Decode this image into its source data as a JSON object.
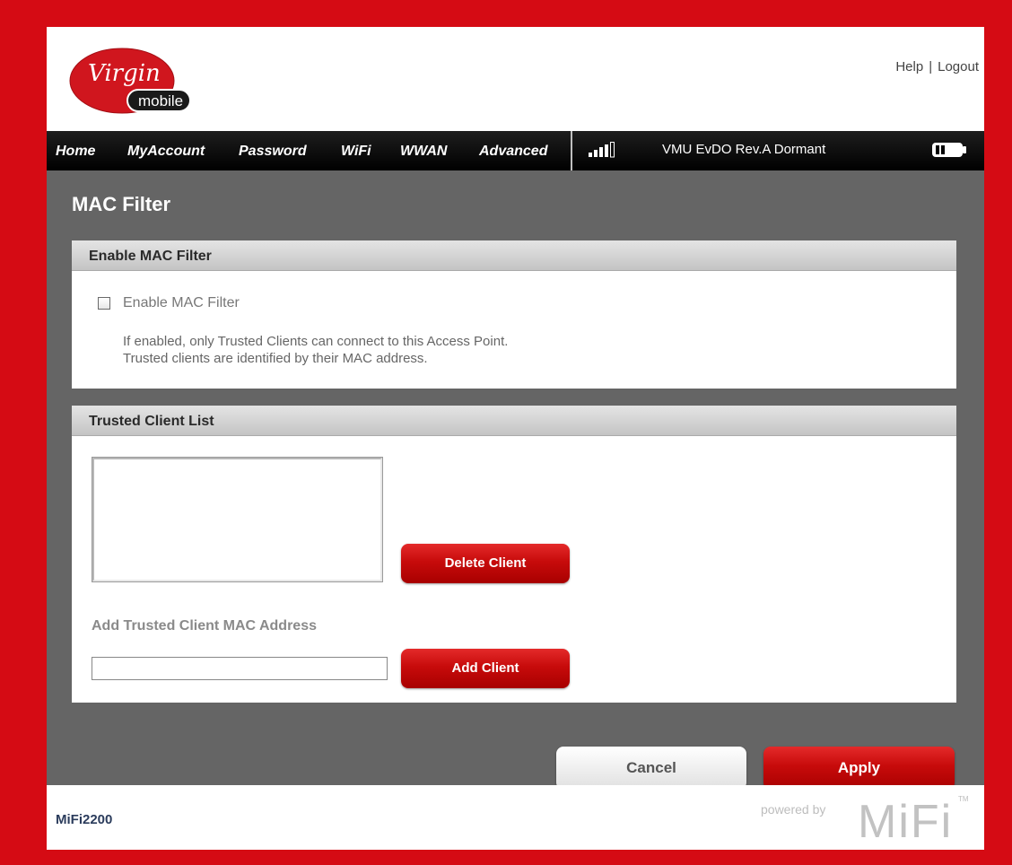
{
  "header": {
    "logo": {
      "brand_top": "Virgin",
      "brand_bottom": "mobile",
      "icon": "virgin-mobile-logo"
    },
    "links": {
      "help": "Help",
      "separator": "|",
      "logout": "Logout"
    }
  },
  "nav": {
    "items": [
      "Home",
      "MyAccount",
      "Password",
      "WiFi",
      "WWAN",
      "Advanced"
    ],
    "status": "VMU  EvDO Rev.A  Dormant",
    "signal_icon": "signal-strength-icon",
    "battery_icon": "battery-icon"
  },
  "page": {
    "title": "MAC Filter"
  },
  "enable_panel": {
    "header": "Enable MAC Filter",
    "checkbox_label": "Enable MAC Filter",
    "checked": false,
    "description_line1": "If enabled, only Trusted Clients can connect to this Access Point.",
    "description_line2": "Trusted clients are identified by their MAC address."
  },
  "trusted_panel": {
    "header": "Trusted Client List",
    "clients": [],
    "delete_label": "Delete Client",
    "add_title": "Add Trusted Client MAC Address",
    "mac_value": "",
    "add_label": "Add Client"
  },
  "actions": {
    "cancel_label": "Cancel",
    "apply_label": "Apply"
  },
  "footer": {
    "model": "MiFi2200",
    "powered_by": "powered by",
    "brand": "MiFi",
    "trademark": "TM"
  },
  "colors": {
    "frame_red": "#d50b14",
    "content_gray": "#656565",
    "button_red": "#c70b0b"
  }
}
